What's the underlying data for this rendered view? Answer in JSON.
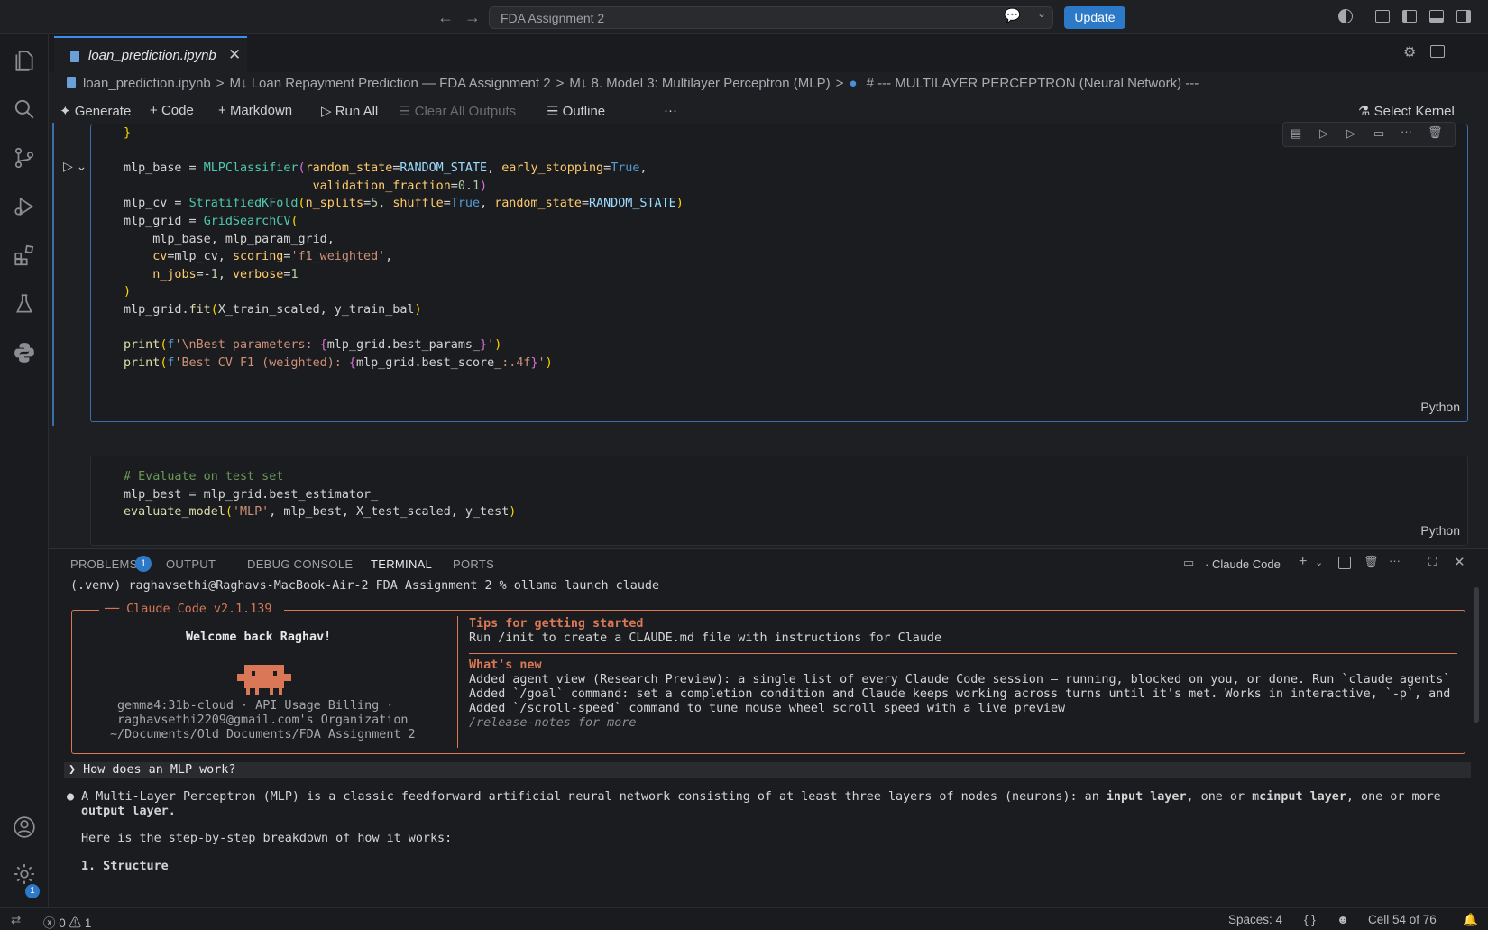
{
  "titlebar": {
    "search_text": "FDA Assignment 2",
    "update_label": "Update"
  },
  "tabs": [
    {
      "label": "loan_prediction.ipynb",
      "active": true
    }
  ],
  "breadcrumb": [
    "loan_prediction.ipynb",
    ">",
    "M↓ Loan Repayment Prediction — FDA Assignment 2",
    ">",
    "M↓ 8. Model 3: Multilayer Perceptron (MLP)",
    ">",
    "# --- MULTILAYER PERCEPTRON (Neural Network) ---"
  ],
  "toolbar": {
    "generate": "Generate",
    "code": "Code",
    "markdown": "Markdown",
    "run_all": "Run All",
    "clear_outputs": "Clear All Outputs",
    "outline": "Outline",
    "more": "···",
    "select_kernel": "Select Kernel"
  },
  "cells": {
    "cell1_lang": "Python",
    "cell2_lang": "Python"
  },
  "panel": {
    "tabs": [
      "PROBLEMS",
      "OUTPUT",
      "DEBUG CONSOLE",
      "TERMINAL",
      "PORTS"
    ],
    "problems_count": "1",
    "terminal_name": "Claude Code"
  },
  "terminal": {
    "command_line": "(.venv) raghavsethi@Raghavs-MacBook-Air-2 FDA Assignment 2 % ollama launch claude",
    "legend": "── Claude Code v2.1.139 ",
    "welcome": "Welcome back Raghav!",
    "account_1": "gemma4:31b-cloud · API Usage Billing ·",
    "account_2": "raghavsethi2209@gmail.com's Organization",
    "account_3": "~/Documents/Old Documents/FDA Assignment 2",
    "tips_title": "Tips for getting started",
    "tips_line": "Run /init to create a CLAUDE.md file with instructions for Claude",
    "whats_new_title": "What's new",
    "new_1": "Added agent view (Research Preview): a single list of every Claude Code session — running, blocked on you, or done. Run `claude agents` …",
    "new_2": "Added `/goal` command: set a completion condition and Claude keeps working across turns until it's met. Works in interactive, `-p`, and …",
    "new_3": "Added `/scroll-speed` command to tune mouse wheel scroll speed with a live preview",
    "release_notes": "/release-notes for more",
    "prompt": "❯ How does an MLP work?",
    "answer_1a": "● A Multi-Layer Perceptron (MLP) is a classic feedforward artificial neural network consisting of at least three layers of nodes (neurons): an ",
    "answer_1b": "input layer",
    "answer_1c": ", one or m",
    "answer_1d": "cinput layer",
    "answer_1e": ", one or more",
    "answer_2": "output layer.",
    "answer_3": "Here is the step-by-step breakdown of how it works:",
    "answer_4": "1. Structure"
  },
  "statusbar": {
    "errors": "0",
    "warnings": "1",
    "spaces": "Spaces: 4",
    "braces": "{ }",
    "cell": "Cell 54 of 76"
  },
  "settings_badge": "1"
}
